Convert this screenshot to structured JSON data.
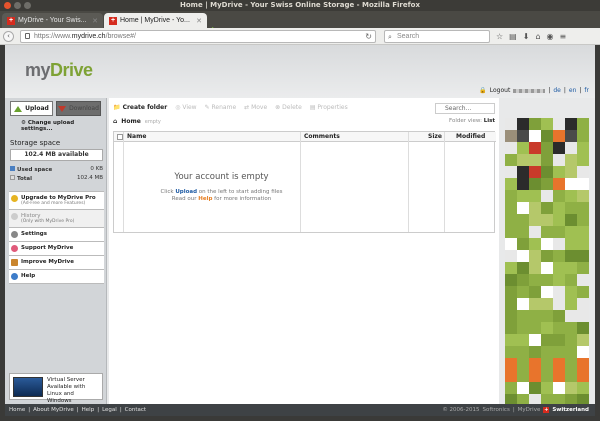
{
  "window": {
    "title": "Home | MyDrive - Your Swiss Online Storage - Mozilla Firefox"
  },
  "tabs": [
    {
      "label": "MyDrive - Your Swis..."
    },
    {
      "label": "Home | MyDrive - Yo..."
    }
  ],
  "nav": {
    "url_prefix": "https://www.",
    "url_domain": "mydrive.ch",
    "url_path": "/browse#/",
    "search_placeholder": "Search"
  },
  "header": {
    "logo_my": "my",
    "logo_drive": "Drive",
    "logout": "Logout",
    "languages": [
      "de",
      "en",
      "fr"
    ]
  },
  "sidebar": {
    "upload": "Upload",
    "download": "Download",
    "upload_settings": "Change upload settings...",
    "storage_heading": "Storage space",
    "available": "102.4 MB available",
    "used_label": "Used space",
    "used_value": "0 KB",
    "total_label": "Total",
    "total_value": "102.4 MB",
    "menu": [
      {
        "label": "Upgrade to MyDrive Pro",
        "sub": "(Ad-Free and more Features)"
      },
      {
        "label": "History",
        "sub": "(Only with MyDrive Pro)"
      },
      {
        "label": "Settings"
      },
      {
        "label": "Support MyDrive"
      },
      {
        "label": "Improve MyDrive"
      },
      {
        "label": "Help"
      }
    ],
    "promo": "Virtual Server Available with Linux and Windows"
  },
  "toolbar": {
    "create_folder": "Create folder",
    "view": "View",
    "rename": "Rename",
    "move": "Move",
    "delete": "Delete",
    "properties": "Properties",
    "search_placeholder": "Search..."
  },
  "breadcrumb": {
    "home": "Home",
    "status": "empty"
  },
  "folder_view": {
    "label": "Folder view:",
    "value": "List"
  },
  "table": {
    "columns": [
      "Name",
      "Comments",
      "Size",
      "Modified"
    ],
    "empty_title": "Your account is empty",
    "empty_line1_a": "Click",
    "empty_line1_b": "Upload",
    "empty_line1_c": "on the left to start adding files",
    "empty_line2_a": "Read our",
    "empty_line2_b": "Help",
    "empty_line2_c": "for more information"
  },
  "footer": {
    "links": [
      "Home",
      "About MyDrive",
      "Help",
      "Legal",
      "Contact"
    ],
    "copyright": "© 2006-2015",
    "company": "Softronics",
    "brand": "MyDrive",
    "country": "Switzerland"
  }
}
